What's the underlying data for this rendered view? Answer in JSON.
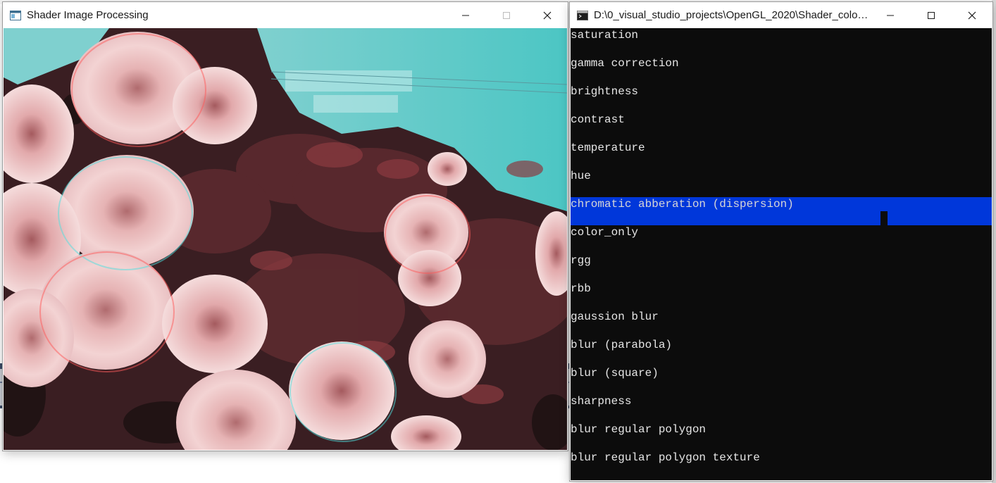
{
  "image_window": {
    "title": "Shader Image Processing",
    "icon": "app-window-icon",
    "controls": {
      "minimize_icon": "minimize-icon",
      "maximize_icon": "maximize-icon",
      "close_icon": "close-icon"
    },
    "content_description_icon": "rose-photo-chromatic-aberration"
  },
  "console_window": {
    "title": "D:\\0_visual_studio_projects\\OpenGL_2020\\Shader_colour...",
    "icon": "console-window-icon",
    "selected_index": 6,
    "items": [
      "saturation",
      "gamma correction",
      "brightness",
      "contrast",
      "temperature",
      "hue",
      "chromatic abberation (dispersion)",
      "color_only",
      "rgg",
      "rbb",
      "gaussion blur",
      "blur (parabola)",
      "blur (square)",
      "sharpness",
      "blur regular polygon",
      "blur regular polygon texture"
    ]
  },
  "colors": {
    "console_bg": "#0c0c0c",
    "console_text": "#e6e6e6",
    "selection_bg": "#0037da"
  }
}
